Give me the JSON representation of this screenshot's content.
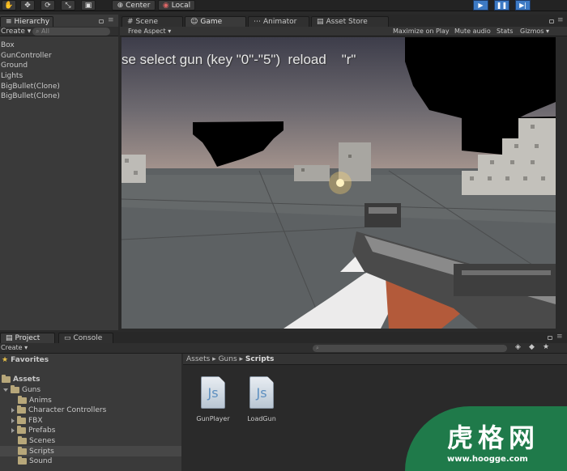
{
  "toolbar": {
    "center_label": "Center",
    "local_label": "Local"
  },
  "hierarchy": {
    "tab_label": "Hierarchy",
    "create_label": "Create",
    "search_placeholder": "All",
    "items": [
      "Box",
      "GunController",
      "Ground",
      "Lights",
      "BigBullet(Clone)",
      "BigBullet(Clone)"
    ]
  },
  "center_tabs": {
    "scene": "Scene",
    "game": "Game",
    "animator": "Animator",
    "asset_store": "Asset Store"
  },
  "game_bar": {
    "aspect": "Free Aspect",
    "maximize": "Maximize on Play",
    "mute": "Mute audio",
    "stats": "Stats",
    "gizmos": "Gizmos"
  },
  "game_view": {
    "overlay_text": "se select gun (key \"0\"-\"5\")  reload    \"r\""
  },
  "project": {
    "tab_label": "Project",
    "console_tab_label": "Console",
    "create_label": "Create",
    "favorites_label": "Favorites",
    "assets_label": "Assets",
    "tree": {
      "guns": "Guns",
      "anims": "Anims",
      "character_controllers": "Character Controllers",
      "fbx": "FBX",
      "prefabs": "Prefabs",
      "scenes": "Scenes",
      "scripts": "Scripts",
      "sound": "Sound"
    },
    "breadcrumb": {
      "assets": "Assets",
      "guns": "Guns",
      "scripts": "Scripts"
    },
    "files": [
      {
        "name": "GunPlayer",
        "icon_text": "Js"
      },
      {
        "name": "LoadGun",
        "icon_text": "Js"
      }
    ]
  },
  "watermark": {
    "title": "虎格网",
    "url": "www.hoogge.com"
  },
  "colors": {
    "play_button": "#3d7ac4",
    "selected_row": "#474747",
    "watermark_green": "#1f7a4a"
  }
}
